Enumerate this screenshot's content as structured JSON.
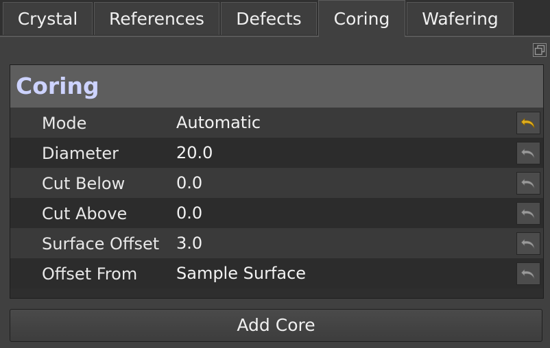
{
  "tabs": [
    {
      "label": "Crystal",
      "active": false
    },
    {
      "label": "References",
      "active": false
    },
    {
      "label": "Defects",
      "active": false
    },
    {
      "label": "Coring",
      "active": true
    },
    {
      "label": "Wafering",
      "active": false
    }
  ],
  "panel": {
    "title": "Coring",
    "rows": [
      {
        "label": "Mode",
        "value": "Automatic",
        "reset_active": true
      },
      {
        "label": "Diameter",
        "value": "20.0",
        "reset_active": false
      },
      {
        "label": "Cut Below",
        "value": "0.0",
        "reset_active": false
      },
      {
        "label": "Cut Above",
        "value": "0.0",
        "reset_active": false
      },
      {
        "label": "Surface Offset",
        "value": "3.0",
        "reset_active": false
      },
      {
        "label": "Offset From",
        "value": "Sample Surface",
        "reset_active": false
      }
    ]
  },
  "add_core_label": "Add Core",
  "colors": {
    "title_text": "#cdd3ff",
    "reset_active": "#e0b020",
    "reset_inactive": "#9a9a9a"
  },
  "icons": {
    "restore": "restore-window-icon",
    "reset": "undo-arrow-icon"
  }
}
